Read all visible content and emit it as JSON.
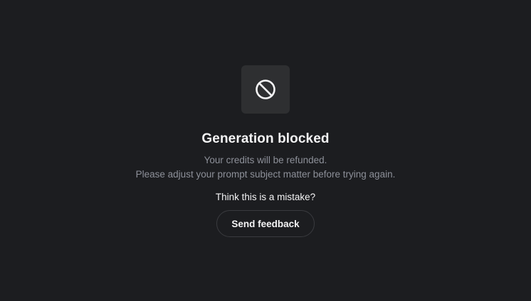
{
  "blocked_notice": {
    "icon": "blocked-icon",
    "title": "Generation blocked",
    "message_line_1": "Your credits will be refunded.",
    "message_line_2": "Please adjust your prompt subject matter before trying again.",
    "question": "Think this is a mistake?",
    "feedback_button_label": "Send feedback"
  },
  "colors": {
    "background": "#1c1d20",
    "icon_tile": "#2e2f31",
    "primary_text": "#f4f4f5",
    "secondary_text": "#8d9099",
    "button_border": "#3a3b3f"
  }
}
